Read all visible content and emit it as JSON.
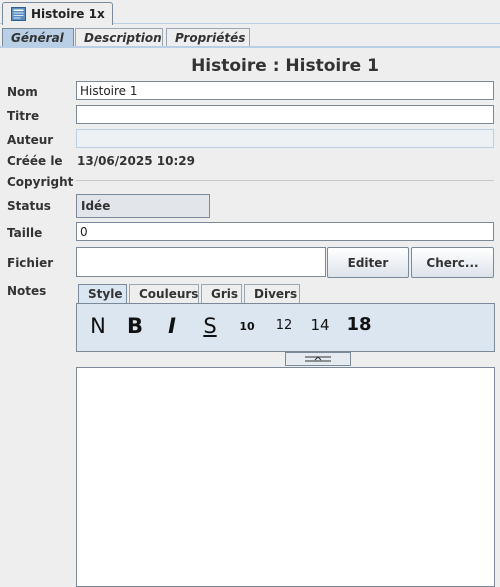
{
  "doc_tab": {
    "title": "Histoire 1",
    "close": "x"
  },
  "prop_tabs": [
    "Général",
    "Description",
    "Propriétés"
  ],
  "heading": "Histoire : Histoire 1",
  "labels": {
    "nom": "Nom",
    "titre": "Titre",
    "auteur": "Auteur",
    "creee": "Créée le",
    "copyright": "Copyright",
    "status": "Status",
    "taille": "Taille",
    "fichier": "Fichier",
    "notes": "Notes"
  },
  "fields": {
    "nom": "Histoire 1",
    "titre": "",
    "auteur": "",
    "creee": "13/06/2025 10:29",
    "status": "Idée",
    "taille": "0",
    "fichier": ""
  },
  "buttons": {
    "editer": "Editer",
    "chercher": "Cherc..."
  },
  "notes_tabs": [
    "Style",
    "Couleurs",
    "Gris",
    "Divers"
  ],
  "style_toolbar": {
    "normal": "N",
    "bold": "B",
    "italic": "I",
    "strike": "S",
    "size10": "10",
    "size12": "12",
    "size14": "14",
    "size18": "18"
  },
  "colors": {
    "selected_tab": "#b8cfe5",
    "border": "#7a8a99",
    "background": "#eeeeee"
  }
}
